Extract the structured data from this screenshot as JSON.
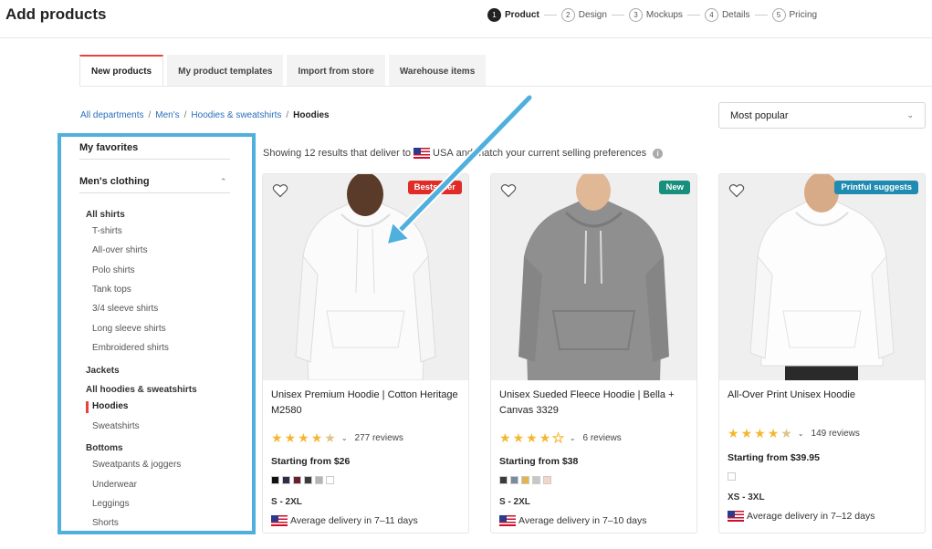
{
  "header": {
    "title": "Add products",
    "steps": [
      {
        "num": "1",
        "label": "Product"
      },
      {
        "num": "2",
        "label": "Design"
      },
      {
        "num": "3",
        "label": "Mockups"
      },
      {
        "num": "4",
        "label": "Details"
      },
      {
        "num": "5",
        "label": "Pricing"
      }
    ]
  },
  "tabs": [
    "New products",
    "My product templates",
    "Import from store",
    "Warehouse items"
  ],
  "breadcrumb": {
    "links": [
      "All departments",
      "Men's",
      "Hoodies & sweatshirts"
    ],
    "separator": "/",
    "current": "Hoodies"
  },
  "sort": {
    "value": "Most popular"
  },
  "sidebar": {
    "favorites": "My favorites",
    "section": "Men's clothing",
    "categories": {
      "all_shirts": "All shirts",
      "jackets": "Jackets",
      "all_hoodies": "All hoodies & sweatshirts",
      "bottoms": "Bottoms"
    },
    "shirts": [
      "T-shirts",
      "All-over shirts",
      "Polo shirts",
      "Tank tops",
      "3/4 sleeve shirts",
      "Long sleeve shirts",
      "Embroidered shirts"
    ],
    "hoodies": [
      "Hoodies",
      "Sweatshirts"
    ],
    "bottoms_items": [
      "Sweatpants & joggers",
      "Underwear",
      "Leggings",
      "Shorts"
    ]
  },
  "results": {
    "prefix": "Showing 12 results that deliver to",
    "country": "USA",
    "suffix": "and match your current selling preferences"
  },
  "products": [
    {
      "badge": "Bestseller",
      "badge_color": "#e02b27",
      "title": "Unisex Premium Hoodie | Cotton Heritage M2580",
      "rating": 4.5,
      "reviews": "277 reviews",
      "price": "Starting from $26",
      "swatches": [
        "#111111",
        "#2b2f45",
        "#6b1e2b",
        "#3b3b3b",
        "#b5b5b5",
        "#ffffff"
      ],
      "sizes": "S - 2XL",
      "delivery": "Average delivery in 7–11 days"
    },
    {
      "badge": "New",
      "badge_color": "#178f7d",
      "title": "Unisex Sueded Fleece Hoodie | Bella + Canvas 3329",
      "rating": 4,
      "reviews": "6 reviews",
      "price": "Starting from $38",
      "swatches": [
        "#3a3a3a",
        "#7a8ba0",
        "#e2b44a",
        "#c7c7c7",
        "#f3d6c6"
      ],
      "sizes": "S - 2XL",
      "delivery": "Average delivery in 7–10 days"
    },
    {
      "badge": "Printful suggests",
      "badge_color": "#1f8bb0",
      "title": "All-Over Print Unisex Hoodie",
      "rating": 4.5,
      "reviews": "149 reviews",
      "price": "Starting from $39.95",
      "swatches": [
        "#ffffff"
      ],
      "sizes": "XS - 3XL",
      "delivery": "Average delivery in 7–12 days"
    }
  ],
  "colors": {
    "accent": "#e8423f",
    "link": "#2a6ebb",
    "highlight": "#4fb0de",
    "star": "#f5b731"
  }
}
